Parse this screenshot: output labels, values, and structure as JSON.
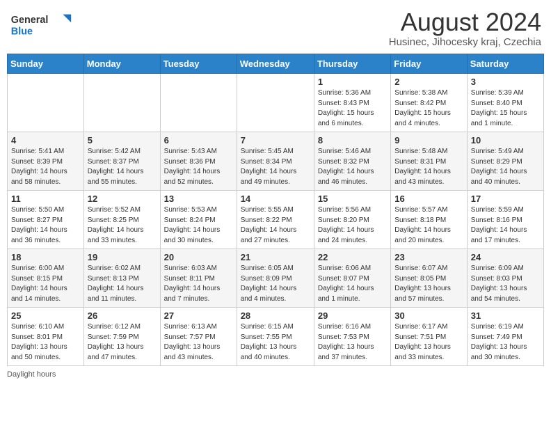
{
  "header": {
    "logo_general": "General",
    "logo_blue": "Blue",
    "main_title": "August 2024",
    "subtitle": "Husinec, Jihocesky kraj, Czechia"
  },
  "calendar": {
    "days_of_week": [
      "Sunday",
      "Monday",
      "Tuesday",
      "Wednesday",
      "Thursday",
      "Friday",
      "Saturday"
    ],
    "weeks": [
      [
        {
          "day": "",
          "info": ""
        },
        {
          "day": "",
          "info": ""
        },
        {
          "day": "",
          "info": ""
        },
        {
          "day": "",
          "info": ""
        },
        {
          "day": "1",
          "info": "Sunrise: 5:36 AM\nSunset: 8:43 PM\nDaylight: 15 hours\nand 6 minutes."
        },
        {
          "day": "2",
          "info": "Sunrise: 5:38 AM\nSunset: 8:42 PM\nDaylight: 15 hours\nand 4 minutes."
        },
        {
          "day": "3",
          "info": "Sunrise: 5:39 AM\nSunset: 8:40 PM\nDaylight: 15 hours\nand 1 minute."
        }
      ],
      [
        {
          "day": "4",
          "info": "Sunrise: 5:41 AM\nSunset: 8:39 PM\nDaylight: 14 hours\nand 58 minutes."
        },
        {
          "day": "5",
          "info": "Sunrise: 5:42 AM\nSunset: 8:37 PM\nDaylight: 14 hours\nand 55 minutes."
        },
        {
          "day": "6",
          "info": "Sunrise: 5:43 AM\nSunset: 8:36 PM\nDaylight: 14 hours\nand 52 minutes."
        },
        {
          "day": "7",
          "info": "Sunrise: 5:45 AM\nSunset: 8:34 PM\nDaylight: 14 hours\nand 49 minutes."
        },
        {
          "day": "8",
          "info": "Sunrise: 5:46 AM\nSunset: 8:32 PM\nDaylight: 14 hours\nand 46 minutes."
        },
        {
          "day": "9",
          "info": "Sunrise: 5:48 AM\nSunset: 8:31 PM\nDaylight: 14 hours\nand 43 minutes."
        },
        {
          "day": "10",
          "info": "Sunrise: 5:49 AM\nSunset: 8:29 PM\nDaylight: 14 hours\nand 40 minutes."
        }
      ],
      [
        {
          "day": "11",
          "info": "Sunrise: 5:50 AM\nSunset: 8:27 PM\nDaylight: 14 hours\nand 36 minutes."
        },
        {
          "day": "12",
          "info": "Sunrise: 5:52 AM\nSunset: 8:25 PM\nDaylight: 14 hours\nand 33 minutes."
        },
        {
          "day": "13",
          "info": "Sunrise: 5:53 AM\nSunset: 8:24 PM\nDaylight: 14 hours\nand 30 minutes."
        },
        {
          "day": "14",
          "info": "Sunrise: 5:55 AM\nSunset: 8:22 PM\nDaylight: 14 hours\nand 27 minutes."
        },
        {
          "day": "15",
          "info": "Sunrise: 5:56 AM\nSunset: 8:20 PM\nDaylight: 14 hours\nand 24 minutes."
        },
        {
          "day": "16",
          "info": "Sunrise: 5:57 AM\nSunset: 8:18 PM\nDaylight: 14 hours\nand 20 minutes."
        },
        {
          "day": "17",
          "info": "Sunrise: 5:59 AM\nSunset: 8:16 PM\nDaylight: 14 hours\nand 17 minutes."
        }
      ],
      [
        {
          "day": "18",
          "info": "Sunrise: 6:00 AM\nSunset: 8:15 PM\nDaylight: 14 hours\nand 14 minutes."
        },
        {
          "day": "19",
          "info": "Sunrise: 6:02 AM\nSunset: 8:13 PM\nDaylight: 14 hours\nand 11 minutes."
        },
        {
          "day": "20",
          "info": "Sunrise: 6:03 AM\nSunset: 8:11 PM\nDaylight: 14 hours\nand 7 minutes."
        },
        {
          "day": "21",
          "info": "Sunrise: 6:05 AM\nSunset: 8:09 PM\nDaylight: 14 hours\nand 4 minutes."
        },
        {
          "day": "22",
          "info": "Sunrise: 6:06 AM\nSunset: 8:07 PM\nDaylight: 14 hours\nand 1 minute."
        },
        {
          "day": "23",
          "info": "Sunrise: 6:07 AM\nSunset: 8:05 PM\nDaylight: 13 hours\nand 57 minutes."
        },
        {
          "day": "24",
          "info": "Sunrise: 6:09 AM\nSunset: 8:03 PM\nDaylight: 13 hours\nand 54 minutes."
        }
      ],
      [
        {
          "day": "25",
          "info": "Sunrise: 6:10 AM\nSunset: 8:01 PM\nDaylight: 13 hours\nand 50 minutes."
        },
        {
          "day": "26",
          "info": "Sunrise: 6:12 AM\nSunset: 7:59 PM\nDaylight: 13 hours\nand 47 minutes."
        },
        {
          "day": "27",
          "info": "Sunrise: 6:13 AM\nSunset: 7:57 PM\nDaylight: 13 hours\nand 43 minutes."
        },
        {
          "day": "28",
          "info": "Sunrise: 6:15 AM\nSunset: 7:55 PM\nDaylight: 13 hours\nand 40 minutes."
        },
        {
          "day": "29",
          "info": "Sunrise: 6:16 AM\nSunset: 7:53 PM\nDaylight: 13 hours\nand 37 minutes."
        },
        {
          "day": "30",
          "info": "Sunrise: 6:17 AM\nSunset: 7:51 PM\nDaylight: 13 hours\nand 33 minutes."
        },
        {
          "day": "31",
          "info": "Sunrise: 6:19 AM\nSunset: 7:49 PM\nDaylight: 13 hours\nand 30 minutes."
        }
      ]
    ]
  },
  "footer": {
    "note": "Daylight hours"
  }
}
